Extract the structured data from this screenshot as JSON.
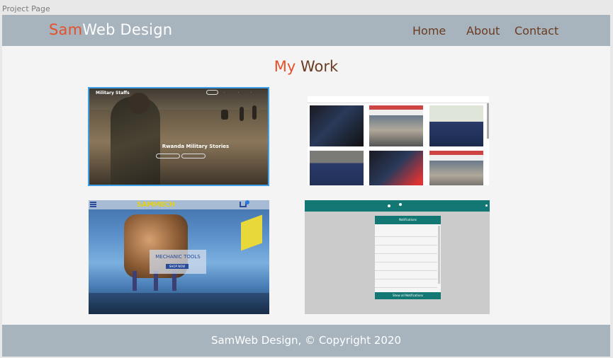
{
  "frame_label": "Project Page",
  "header": {
    "logo_accent": "Sam",
    "logo_rest": "Web Design",
    "nav": {
      "home": "Home",
      "about": "About",
      "contact": "Contact"
    }
  },
  "section": {
    "title_accent": "My",
    "title_rest": " Work"
  },
  "projects": {
    "military": {
      "brand": "Military Staffs",
      "hero": "Rwanda Military Stories"
    },
    "mechanic": {
      "logo": "SAMMECH",
      "card_title": "MECHANIC TOOLS",
      "button": "SHOP NOW"
    },
    "notifications": {
      "panel_title": "Notifications",
      "footer_button": "Show all Notifications"
    }
  },
  "footer": {
    "text": "SamWeb Design, © Copyright 2020"
  },
  "colors": {
    "header_bg": "#a7b4be",
    "accent": "#e4512b",
    "brown": "#6b3b22",
    "teal": "#137874"
  }
}
